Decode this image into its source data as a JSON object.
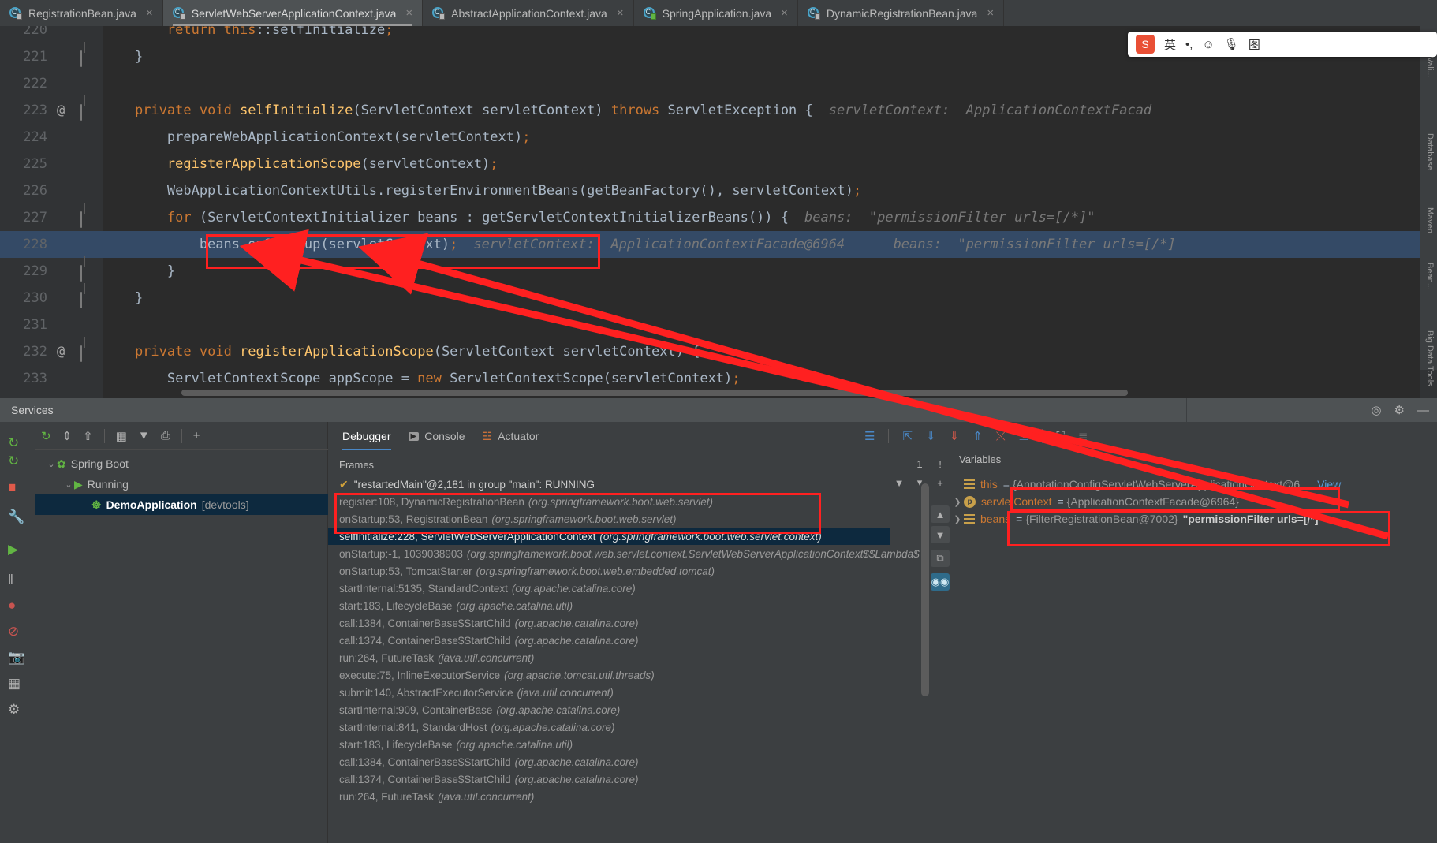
{
  "editor_tabs": [
    {
      "label": "RegistrationBean.java",
      "active": false,
      "icon": "java-class-icon"
    },
    {
      "label": "ServletWebServerApplicationContext.java",
      "active": true,
      "icon": "java-class-icon"
    },
    {
      "label": "AbstractApplicationContext.java",
      "active": false,
      "icon": "java-class-icon"
    },
    {
      "label": "SpringApplication.java",
      "active": false,
      "icon": "java-class-runnable-icon"
    },
    {
      "label": "DynamicRegistrationBean.java",
      "active": false,
      "icon": "java-class-icon"
    }
  ],
  "close_glyph": "×",
  "editor": {
    "lines": [
      {
        "num": "220",
        "at": false,
        "fold": false,
        "text": "        return this::selfInitialize;",
        "hint": "",
        "highlight": "none",
        "clipped_top": true
      },
      {
        "num": "221",
        "at": false,
        "fold": true,
        "text": "    }",
        "hint": "",
        "highlight": "none"
      },
      {
        "num": "222",
        "at": false,
        "fold": false,
        "text": "",
        "hint": "",
        "highlight": "none"
      },
      {
        "num": "223",
        "at": true,
        "fold": true,
        "text": "    private void selfInitialize(ServletContext servletContext) throws ServletException {",
        "hint": "servletContext:  ApplicationContextFacad",
        "highlight": "none"
      },
      {
        "num": "224",
        "at": false,
        "fold": false,
        "text": "        prepareWebApplicationContext(servletContext);",
        "hint": "",
        "highlight": "none"
      },
      {
        "num": "225",
        "at": false,
        "fold": false,
        "text": "        registerApplicationScope(servletContext);",
        "hint": "",
        "highlight": "none"
      },
      {
        "num": "226",
        "at": false,
        "fold": false,
        "text": "        WebApplicationContextUtils.registerEnvironmentBeans(getBeanFactory(), servletContext);",
        "hint": "",
        "highlight": "none"
      },
      {
        "num": "227",
        "at": false,
        "fold": true,
        "text": "        for (ServletContextInitializer beans : getServletContextInitializerBeans()) {",
        "hint": "beans:  \"permissionFilter urls=[/*]\"",
        "highlight": "none"
      },
      {
        "num": "228",
        "at": false,
        "fold": false,
        "text": "            beans.onStartup(servletContext);",
        "hint": "servletContext:  ApplicationContextFacade@6964      beans:  \"permissionFilter urls=[/*]",
        "highlight": "current"
      },
      {
        "num": "229",
        "at": false,
        "fold": true,
        "text": "        }",
        "hint": "",
        "highlight": "none"
      },
      {
        "num": "230",
        "at": false,
        "fold": true,
        "text": "    }",
        "hint": "",
        "highlight": "none"
      },
      {
        "num": "231",
        "at": false,
        "fold": false,
        "text": "",
        "hint": "",
        "highlight": "none"
      },
      {
        "num": "232",
        "at": true,
        "fold": true,
        "text": "    private void registerApplicationScope(ServletContext servletContext) {",
        "hint": "",
        "highlight": "none"
      },
      {
        "num": "233",
        "at": false,
        "fold": false,
        "text": "        ServletContextScope appScope = new ServletContextScope(servletContext);",
        "hint": "",
        "highlight": "none"
      }
    ],
    "keywords": [
      "return",
      "this",
      "private",
      "void",
      "throws",
      "for",
      "new"
    ],
    "method_names": [
      "selfInitialize",
      "registerApplicationScope"
    ]
  },
  "ime_bar": {
    "logo": "S",
    "items": [
      "英",
      "•,",
      "☺",
      "🎙",
      "图"
    ]
  },
  "right_strip_labels": [
    "Bean Vali...",
    "Database",
    "Maven",
    "Bean...",
    "Big Data Tools"
  ],
  "services": {
    "title": "Services",
    "toolbar_icons": [
      "rerun-icon",
      "expand-all-icon",
      "collapse-all-icon",
      "group-by-icon",
      "filter-icon",
      "add-tab-icon",
      "add-icon"
    ],
    "header_right_icons": [
      "target-icon",
      "settings-gear-icon",
      "minimize-icon"
    ],
    "tree": [
      {
        "label": "Spring Boot",
        "level": 0,
        "expanded": true,
        "icon": "spring-boot-icon",
        "selected": false
      },
      {
        "label": "Running",
        "level": 1,
        "expanded": true,
        "icon": "run-icon",
        "selected": false
      },
      {
        "label": "DemoApplication",
        "suffix": "[devtools]",
        "level": 2,
        "expanded": false,
        "icon": "debug-bug-icon",
        "selected": true
      }
    ]
  },
  "left_rail_icons": [
    "rerun-icon",
    "rerun-failed-icon",
    "stop-icon",
    "wrench-icon",
    "resume-icon",
    "pause-icon",
    "mute-breakpoints-icon",
    "breakpoints-off-icon",
    "camera-icon",
    "layout-icon",
    "settings-gear-icon"
  ],
  "debugger": {
    "tabs": [
      {
        "label": "Debugger",
        "active": true,
        "icon": ""
      },
      {
        "label": "Console",
        "active": false,
        "icon": "console-icon"
      },
      {
        "label": "Actuator",
        "active": false,
        "icon": "actuator-icon"
      }
    ],
    "toolbar_icons": [
      "show-execution-point-icon",
      "step-over-icon",
      "step-into-icon",
      "force-step-into-icon",
      "step-out-icon",
      "drop-frame-icon",
      "run-to-cursor-icon",
      "evaluate-expression-icon",
      "settings-icon"
    ],
    "frames_header": "Frames",
    "frames": [
      {
        "text": "\"restartedMain\"@2,181 in group \"main\": RUNNING",
        "pkg": "",
        "type": "thread"
      },
      {
        "text": "register:108, DynamicRegistrationBean",
        "pkg": "(org.springframework.boot.web.servlet)",
        "type": "frame"
      },
      {
        "text": "onStartup:53, RegistrationBean",
        "pkg": "(org.springframework.boot.web.servlet)",
        "type": "frame"
      },
      {
        "text": "selfInitialize:228, ServletWebServerApplicationContext",
        "pkg": "(org.springframework.boot.web.servlet.context)",
        "type": "frame",
        "selected": true
      },
      {
        "text": "onStartup:-1, 1039038903",
        "pkg": "(org.springframework.boot.web.servlet.context.ServletWebServerApplicationContext$$Lambda$",
        "type": "frame"
      },
      {
        "text": "onStartup:53, TomcatStarter",
        "pkg": "(org.springframework.boot.web.embedded.tomcat)",
        "type": "frame"
      },
      {
        "text": "startInternal:5135, StandardContext",
        "pkg": "(org.apache.catalina.core)",
        "type": "frame"
      },
      {
        "text": "start:183, LifecycleBase",
        "pkg": "(org.apache.catalina.util)",
        "type": "frame"
      },
      {
        "text": "call:1384, ContainerBase$StartChild",
        "pkg": "(org.apache.catalina.core)",
        "type": "frame"
      },
      {
        "text": "call:1374, ContainerBase$StartChild",
        "pkg": "(org.apache.catalina.core)",
        "type": "frame"
      },
      {
        "text": "run:264, FutureTask",
        "pkg": "(java.util.concurrent)",
        "type": "frame"
      },
      {
        "text": "execute:75, InlineExecutorService",
        "pkg": "(org.apache.tomcat.util.threads)",
        "type": "frame"
      },
      {
        "text": "submit:140, AbstractExecutorService",
        "pkg": "(java.util.concurrent)",
        "type": "frame"
      },
      {
        "text": "startInternal:909, ContainerBase",
        "pkg": "(org.apache.catalina.core)",
        "type": "frame"
      },
      {
        "text": "startInternal:841, StandardHost",
        "pkg": "(org.apache.catalina.core)",
        "type": "frame"
      },
      {
        "text": "start:183, LifecycleBase",
        "pkg": "(org.apache.catalina.util)",
        "type": "frame"
      },
      {
        "text": "call:1384, ContainerBase$StartChild",
        "pkg": "(org.apache.catalina.core)",
        "type": "frame"
      },
      {
        "text": "call:1374, ContainerBase$StartChild",
        "pkg": "(org.apache.catalina.core)",
        "type": "frame"
      },
      {
        "text": "run:264, FutureTask",
        "pkg": "(java.util.concurrent)",
        "type": "frame"
      }
    ],
    "frame_buttons": [
      "1",
      "!",
      "filter-icon",
      "chevron-down-icon",
      "add-icon",
      "up-arrow-icon",
      "down-arrow-icon",
      "copy-icon",
      "watches-icon"
    ],
    "variables_header": "Variables",
    "variables": [
      {
        "name": "this",
        "value": "{AnnotationConfigServletWebServerApplicationContext@6…",
        "link": "View",
        "icon": "stack-icon",
        "expandable": false
      },
      {
        "name": "servletContext",
        "value": "{ApplicationContextFacade@6964}",
        "link": "",
        "icon": "parameter-icon",
        "expandable": true
      },
      {
        "name": "beans",
        "value": "{FilterRegistrationBean@7002}",
        "string": "\"permissionFilter urls=[/*]\"",
        "link": "",
        "icon": "stack-icon",
        "expandable": true
      }
    ]
  },
  "annotations": {
    "color": "#ff2020",
    "boxes": [
      "code-line-228-box",
      "frames-register-onstartup-box",
      "variables-servletcontext-box",
      "variables-beans-box"
    ],
    "arrows": 2
  }
}
